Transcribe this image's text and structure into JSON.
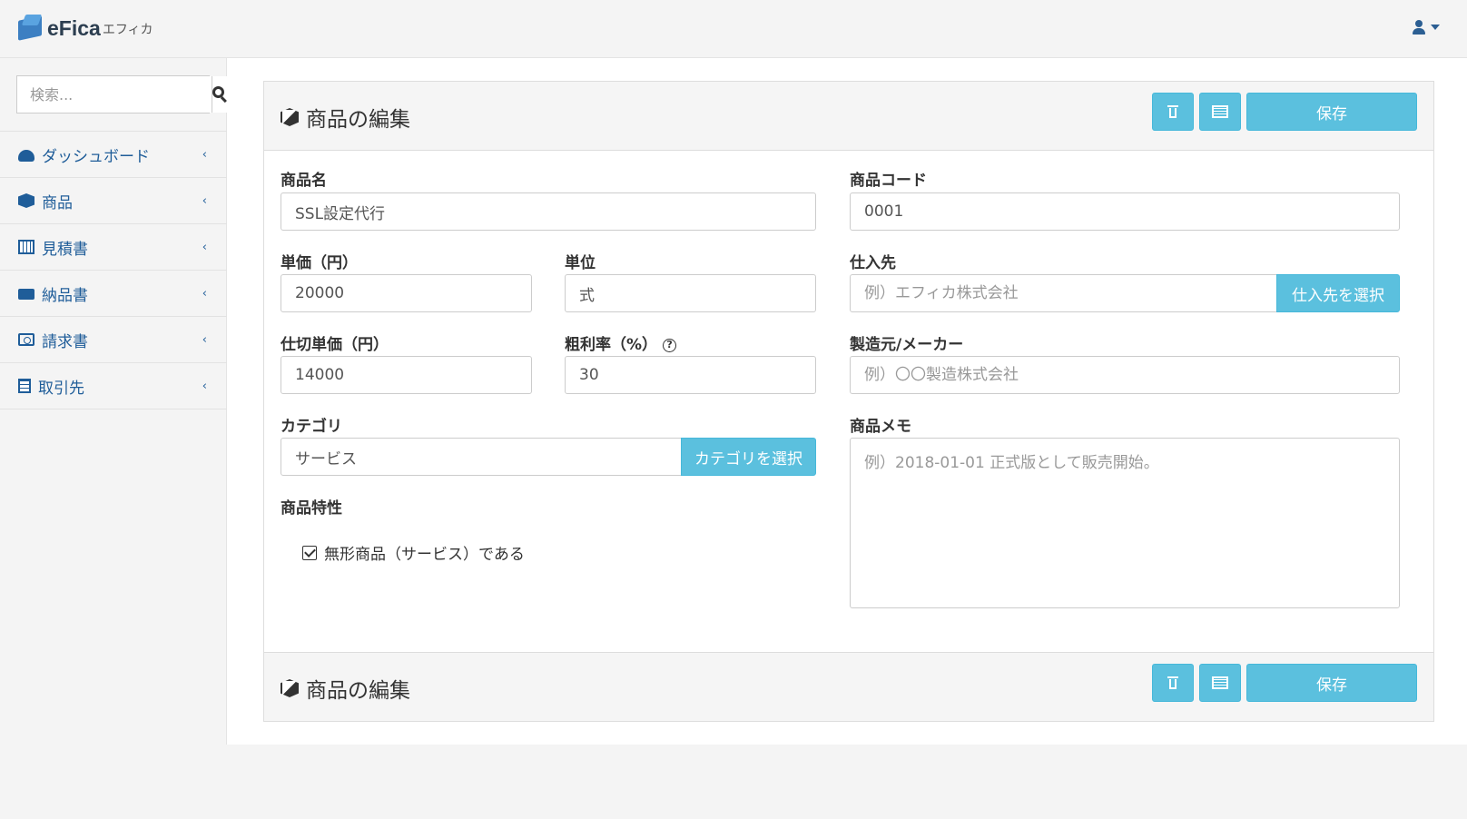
{
  "app": {
    "brand": "eFica",
    "brand_kana": "エフィカ"
  },
  "search": {
    "placeholder": "検索..."
  },
  "sidebar": {
    "items": [
      {
        "label": "ダッシュボード",
        "icon": "dashboard-icon"
      },
      {
        "label": "商品",
        "icon": "cube-icon"
      },
      {
        "label": "見積書",
        "icon": "calculator-icon"
      },
      {
        "label": "納品書",
        "icon": "truck-icon"
      },
      {
        "label": "請求書",
        "icon": "money-icon"
      },
      {
        "label": "取引先",
        "icon": "building-icon"
      }
    ]
  },
  "panel": {
    "title": "商品の編集",
    "save_label": "保存",
    "footer_title": "商品の編集",
    "footer_save_label": "保存"
  },
  "form": {
    "product_name": {
      "label": "商品名",
      "value": "SSL設定代行"
    },
    "product_code": {
      "label": "商品コード",
      "value": "0001"
    },
    "unit_price": {
      "label": "単価（円）",
      "value": "20000"
    },
    "unit": {
      "label": "単位",
      "value": "式"
    },
    "supplier": {
      "label": "仕入先",
      "placeholder": "例）エフィカ株式会社",
      "button": "仕入先を選択"
    },
    "cost_price": {
      "label": "仕切単価（円）",
      "value": "14000"
    },
    "margin": {
      "label": "粗利率（%）",
      "value": "30"
    },
    "maker": {
      "label": "製造元/メーカー",
      "placeholder": "例）〇〇製造株式会社"
    },
    "category": {
      "label": "カテゴリ",
      "value": "サービス",
      "button": "カテゴリを選択"
    },
    "memo": {
      "label": "商品メモ",
      "placeholder": "例）2018-01-01 正式版として販売開始。"
    },
    "traits": {
      "label": "商品特性",
      "checkbox_label": "無形商品（サービス）である",
      "checked": true
    }
  },
  "colors": {
    "accent": "#5bc0de",
    "link": "#1f5d99"
  }
}
